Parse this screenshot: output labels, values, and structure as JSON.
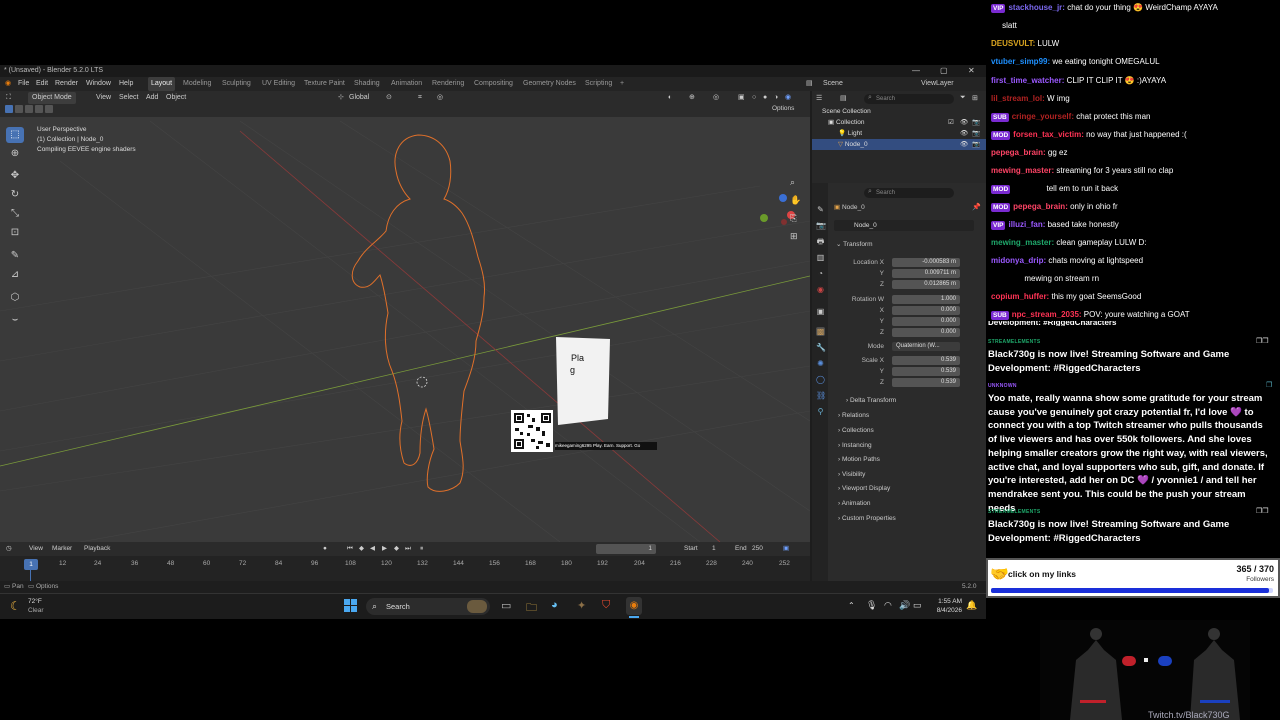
{
  "blender": {
    "title": "* (Unsaved) - Blender 5.2.0 LTS",
    "menus": [
      "File",
      "Edit",
      "Render",
      "Window",
      "Help"
    ],
    "workspaces": [
      "Layout",
      "Modeling",
      "Sculpting",
      "UV Editing",
      "Texture Paint",
      "Shading",
      "Animation",
      "Rendering",
      "Compositing",
      "Geometry Nodes",
      "Scripting"
    ],
    "add_workspace": "+",
    "scene_label": "Scene",
    "view_layer_label": "ViewLayer",
    "viewport": {
      "mode": "Object Mode",
      "menu": [
        "View",
        "Select",
        "Add",
        "Object"
      ],
      "orientation": "Global",
      "options": "Options",
      "overlay_lines": [
        "User Perspective",
        "(1) Collection | Node_0",
        "Compiling EEVEE engine shaders"
      ],
      "card_text_1": "Pla",
      "card_text_2": "g",
      "qr_caption": "mikeegaming6295 Play. Earn. Support. Go"
    },
    "timeline": {
      "menu": [
        "View",
        "Marker",
        "Playback"
      ],
      "current_frame": "1",
      "start_label": "Start",
      "start": "1",
      "end_label": "End",
      "end": "250",
      "ticks": [
        "12",
        "24",
        "36",
        "48",
        "60",
        "72",
        "84",
        "96",
        "108",
        "120",
        "132",
        "144",
        "156",
        "168",
        "180",
        "192",
        "204",
        "216",
        "228",
        "240",
        "252"
      ],
      "playhead": "1"
    },
    "outliner": {
      "search_placeholder": "Search",
      "rows": [
        "Scene Collection",
        "Collection",
        "Light",
        "Node_0"
      ]
    },
    "properties": {
      "search_placeholder": "Search",
      "object_name": "Node_0",
      "object_field": "Node_0",
      "transform_label": "Transform",
      "location_label": "Location X",
      "location": [
        "-0.000583 m",
        "0.009711 m",
        "0.012865 m"
      ],
      "rotation_label": "Rotation W",
      "rotation": [
        "1.000",
        "0.000",
        "0.000",
        "0.000"
      ],
      "mode_label": "Mode",
      "mode_value": "Quaternion (W...",
      "scale_label": "Scale X",
      "scale": [
        "0.539",
        "0.539",
        "0.539"
      ],
      "axis_y": "Y",
      "axis_z": "Z",
      "axis_x": "X",
      "sections": [
        "Delta Transform",
        "Relations",
        "Collections",
        "Instancing",
        "Motion Paths",
        "Visibility",
        "Viewport Display",
        "Animation",
        "Custom Properties"
      ]
    },
    "status": {
      "left": "Pan",
      "middle": "Options",
      "version": "5.2.0"
    }
  },
  "taskbar": {
    "weather_temp": "72°F",
    "weather_cond": "Clear",
    "search": "Search",
    "time": "1:55 AM",
    "date": "8/4/2026"
  },
  "chat": [
    {
      "badge": "VIP",
      "user": "stackhouse_jr:",
      "color": "#7b68ee",
      "msg": "chat do your thing 😍 WeirdChamp AYAYA"
    },
    {
      "badge": "",
      "user": "",
      "color": "#fff",
      "msg": "     slatt"
    },
    {
      "badge": "",
      "user": "DEUSVULT:",
      "color": "#daa520",
      "msg": "LULW"
    },
    {
      "badge": "",
      "user": "vtuber_simp99:",
      "color": "#1e90ff",
      "msg": "we eating tonight OMEGALUL"
    },
    {
      "badge": "",
      "user": "first_time_watcher:",
      "color": "#9b59ff",
      "msg": "CLIP IT CLIP IT 😍 :)AYAYA"
    },
    {
      "badge": "",
      "user": "lil_stream_lol:",
      "color": "#b22222",
      "msg": "W img"
    },
    {
      "badge": "SUB",
      "user": "cringe_yourself:",
      "color": "#b22222",
      "msg": "chat protect this man"
    },
    {
      "badge": "MOD",
      "user": "forsen_tax_victim:",
      "color": "#ff3355",
      "msg": "no way that just happened :("
    },
    {
      "badge": "",
      "user": "pepega_brain:",
      "color": "#ff4466",
      "msg": "gg ez"
    },
    {
      "badge": "",
      "user": "mewing_master:",
      "color": "#ff4466",
      "msg": "streaming for 3 years still no clap"
    },
    {
      "badge": "MOD",
      "user": "",
      "color": "#ff4466",
      "msg": "               tell em to run it back"
    },
    {
      "badge": "MOD",
      "user": "pepega_brain:",
      "color": "#ff4466",
      "msg": "only in ohio fr"
    },
    {
      "badge": "VIP",
      "user": "illuzi_fan:",
      "color": "#9b59ff",
      "msg": "based take honestly"
    },
    {
      "badge": "",
      "user": "mewing_master:",
      "color": "#1fa86b",
      "msg": "clean gameplay LULW D:"
    },
    {
      "badge": "",
      "user": "midonya_drip:",
      "color": "#9b59ff",
      "msg": "chats moving at lightspeed"
    },
    {
      "badge": "",
      "user": "",
      "color": "#fff",
      "msg": "               mewing on stream rn"
    },
    {
      "badge": "",
      "user": "copium_huffer:",
      "color": "#ff3355",
      "msg": "this my goat SeemsGood"
    },
    {
      "badge": "SUB",
      "user": "npc_stream_2035:",
      "color": "#ff3355",
      "msg": "POV: youre watching a GOAT"
    }
  ],
  "streamelements": {
    "tag1": "STREAMELEMENTS",
    "msg1": "Black730g is now live! Streaming Software and Game Development: #RiggedCharacters",
    "tag2": "UNKNOWN",
    "msg2": "Yoo mate, really wanna show some gratitude for your stream cause you've genuinely got crazy potential fr, I'd love 💜 to connect you with a top Twitch streamer who pulls thousands of live viewers and has over 550k followers. And she loves helping smaller creators grow the right way, with real viewers, active chat, and loyal supporters who sub, gift, and donate. If you're interested, add her on DC 💜 / yvonnie1 / and tell her mendrakee sent you. This could be the push your stream needs",
    "tag3": "STREAMELEMENTS",
    "msg3": "Black730g is now live! Streaming Software and Game Development: #RiggedCharacters",
    "follow_text": "click on my links",
    "follow_count": "365 / 370",
    "follow_label": "Followers",
    "follow_progress": 0.986
  },
  "cam": {
    "handle": "Twitch.tv/Black730G"
  }
}
